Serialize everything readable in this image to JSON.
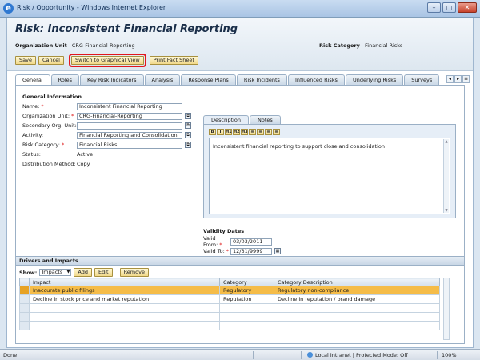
{
  "window": {
    "title": "Risk / Opportunity - Windows Internet Explorer",
    "min": "–",
    "max": "□",
    "close": "✕"
  },
  "header": {
    "title": "Risk: Inconsistent Financial Reporting",
    "org_unit_label": "Organization Unit",
    "org_unit_value": "CRG-Financial-Reporting",
    "risk_category_label": "Risk Category",
    "risk_category_value": "Financial Risks"
  },
  "toolbar": {
    "save": "Save",
    "cancel": "Cancel",
    "graphical": "Switch to Graphical View",
    "fact_sheet": "Print Fact Sheet"
  },
  "tabs": [
    "General",
    "Roles",
    "Key Risk Indicators",
    "Analysis",
    "Response Plans",
    "Risk Incidents",
    "Influenced Risks",
    "Underlying Risks",
    "Surveys"
  ],
  "tabnav": {
    "prev": "◂",
    "next": "▸",
    "list": "≡"
  },
  "general": {
    "section_title": "General Information",
    "name_label": "Name:",
    "name_value": "Inconsistent Financial Reporting",
    "org_label": "Organization Unit:",
    "org_value": "CRG-Financial-Reporting",
    "sec_org_label": "Secondary Org. Unit:",
    "sec_org_value": "",
    "activity_label": "Activity:",
    "activity_value": "Financial Reporting and Consolidation",
    "riskcat_label": "Risk Category:",
    "riskcat_value": "Financial Risks",
    "status_label": "Status:",
    "status_value": "Active",
    "dist_label": "Distribution Method:",
    "dist_value": "Copy",
    "required_mark": "*"
  },
  "description": {
    "tabs": [
      "Description",
      "Notes"
    ],
    "tools": [
      "B",
      "I",
      "H1",
      "H2",
      "H3",
      "≡",
      "≡",
      "≡",
      "≡"
    ],
    "text": "Inconsistent financial reporting to support close and consolidation"
  },
  "validity": {
    "title": "Validity Dates",
    "from_label": "Valid From:",
    "from_value": "03/03/2011",
    "to_label": "Valid To:",
    "to_value": "12/31/9999"
  },
  "drivers": {
    "title": "Drivers and Impacts",
    "show_label": "Show:",
    "show_value": "Impacts",
    "add": "Add",
    "edit": "Edit",
    "remove": "Remove",
    "columns": [
      "Impact",
      "Category",
      "Category Description"
    ],
    "rows": [
      [
        "Inaccurate public filings",
        "Regulatory",
        "Regulatory non-compliance"
      ],
      [
        "Decline in stock price and market reputation",
        "Reputation",
        "Decline in reputation / brand damage"
      ]
    ]
  },
  "statusbar": {
    "done": "Done",
    "zone": "Local intranet | Protected Mode: Off",
    "zoom": "100%"
  },
  "colors": {
    "highlight_row": "#f5bc48",
    "button_outline": "#e2161d",
    "header_bg": "#dde7f0"
  }
}
